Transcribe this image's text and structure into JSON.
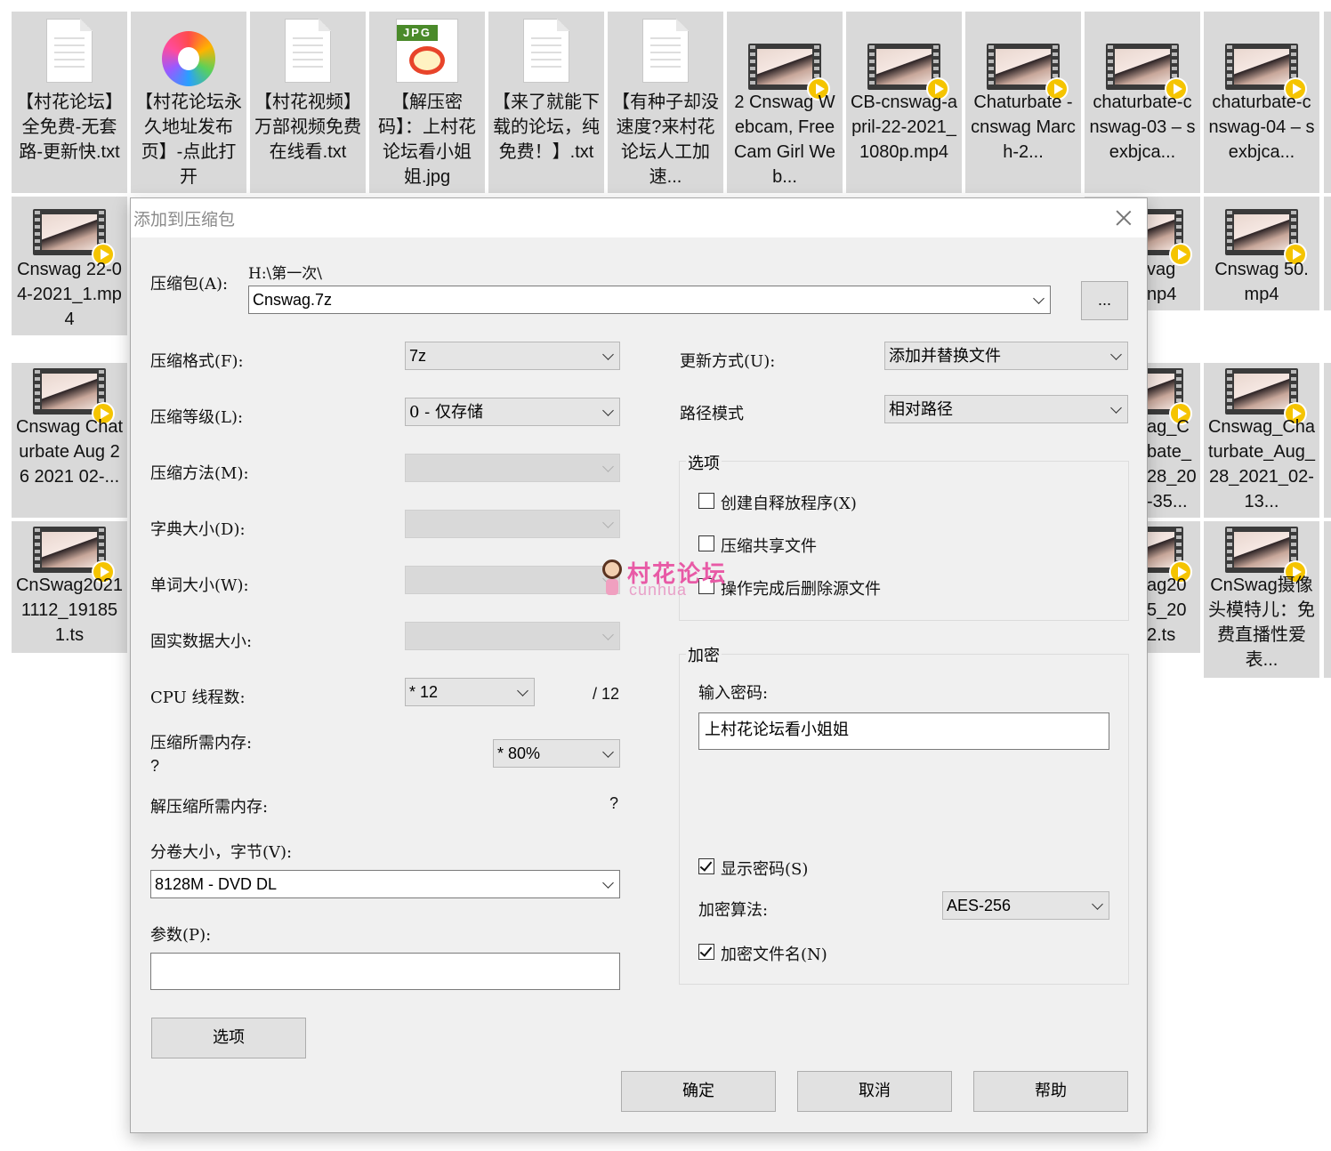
{
  "desktop": {
    "files_row1": [
      {
        "label": "【村花论坛】全免费-无套路-更新快.txt",
        "icon": "text-file-icon"
      },
      {
        "label": "【村花论坛永久地址发布页】-点此打开",
        "icon": "browser-shortcut-icon"
      },
      {
        "label": "【村花视频】万部视频免费在线看.txt",
        "icon": "text-file-icon"
      },
      {
        "label": "【解压密码】：上村花论坛看小姐姐.jpg",
        "icon": "jpg-file-icon"
      },
      {
        "label": "【来了就能下载的论坛，纯免费！】.txt",
        "icon": "text-file-icon"
      },
      {
        "label": "【有种子却没速度?来村花论坛人工加速...",
        "icon": "text-file-icon"
      },
      {
        "label": "2 Cnswag Webcam, Free Cam Girl Web...",
        "icon": "video-file-icon"
      },
      {
        "label": "CB-cnswag-april-22-2021_1080p.mp4",
        "icon": "video-file-icon"
      },
      {
        "label": "Chaturbate - cnswag March-2...",
        "icon": "video-file-icon"
      },
      {
        "label": "chaturbate-cnswag-03 – sexbjca...",
        "icon": "video-file-icon"
      },
      {
        "label": "chaturbate-cnswag-04 – sexbjca...",
        "icon": "video-file-icon"
      }
    ],
    "files_left": [
      {
        "label": "Cnswag 22-04-2021_1.mp4",
        "icon": "video-file-icon"
      },
      {
        "label": "Cnswag Chaturbate Aug 26 2021 02-...",
        "icon": "video-file-icon"
      },
      {
        "label": "CnSwag20211112_191851.ts",
        "icon": "video-file-icon"
      }
    ],
    "files_right_partial": [
      {
        "label": "vag\nnp4",
        "icon": "video-file-icon"
      },
      {
        "label": "ag_C\nbate_\n28_20\n-35...",
        "icon": "video-file-icon"
      },
      {
        "label": "ag20\n5_20\n2.ts",
        "icon": "video-file-icon"
      }
    ],
    "files_right": [
      {
        "label": "Cnswag 50.mp4",
        "icon": "video-file-icon"
      },
      {
        "label": "Cnswag_Chaturbate_Aug_28_2021_02-13...",
        "icon": "video-file-icon"
      },
      {
        "label": "CnSwag摄像头模特儿：免费直播性爱表...",
        "icon": "video-file-icon"
      }
    ]
  },
  "dialog": {
    "title": "添加到压缩包",
    "archive_label": "压缩包(A):",
    "archive_path": "H:\\第一次\\",
    "archive_name": "Cnswag.7z",
    "browse_label": "...",
    "format_label": "压缩格式(F):",
    "format_value": "7z",
    "level_label": "压缩等级(L):",
    "level_value": "0 - 仅存储",
    "method_label": "压缩方法(M):",
    "dict_label": "字典大小(D):",
    "word_label": "单词大小(W):",
    "solid_label": "固实数据大小:",
    "threads_label": "CPU 线程数:",
    "threads_value": "* 12",
    "threads_total": "/ 12",
    "mem_compress_label": "压缩所需内存:",
    "mem_compress_value": "?",
    "mem_percent_value": "* 80%",
    "mem_decompress_label": "解压缩所需内存:",
    "mem_decompress_value": "?",
    "volume_label": "分卷大小，字节(V):",
    "volume_value": "8128M - DVD DL",
    "params_label": "参数(P):",
    "params_value": "",
    "options_button": "选项",
    "update_label": "更新方式(U):",
    "update_value": "添加并替换文件",
    "path_mode_label": "路径模式",
    "path_mode_value": "相对路径",
    "options_group": "选项",
    "opt_sfx": "创建自释放程序(X)",
    "opt_shared": "压缩共享文件",
    "opt_delete": "操作完成后删除源文件",
    "encrypt_group": "加密",
    "password_label": "输入密码:",
    "password_value": "上村花论坛看小姐姐",
    "show_password": "显示密码(S)",
    "enc_method_label": "加密算法:",
    "enc_method_value": "AES-256",
    "encrypt_names": "加密文件名(N)",
    "ok_button": "确定",
    "cancel_button": "取消",
    "help_button": "帮助"
  },
  "watermark": {
    "text": "村花论坛",
    "sub": "cunhua"
  }
}
